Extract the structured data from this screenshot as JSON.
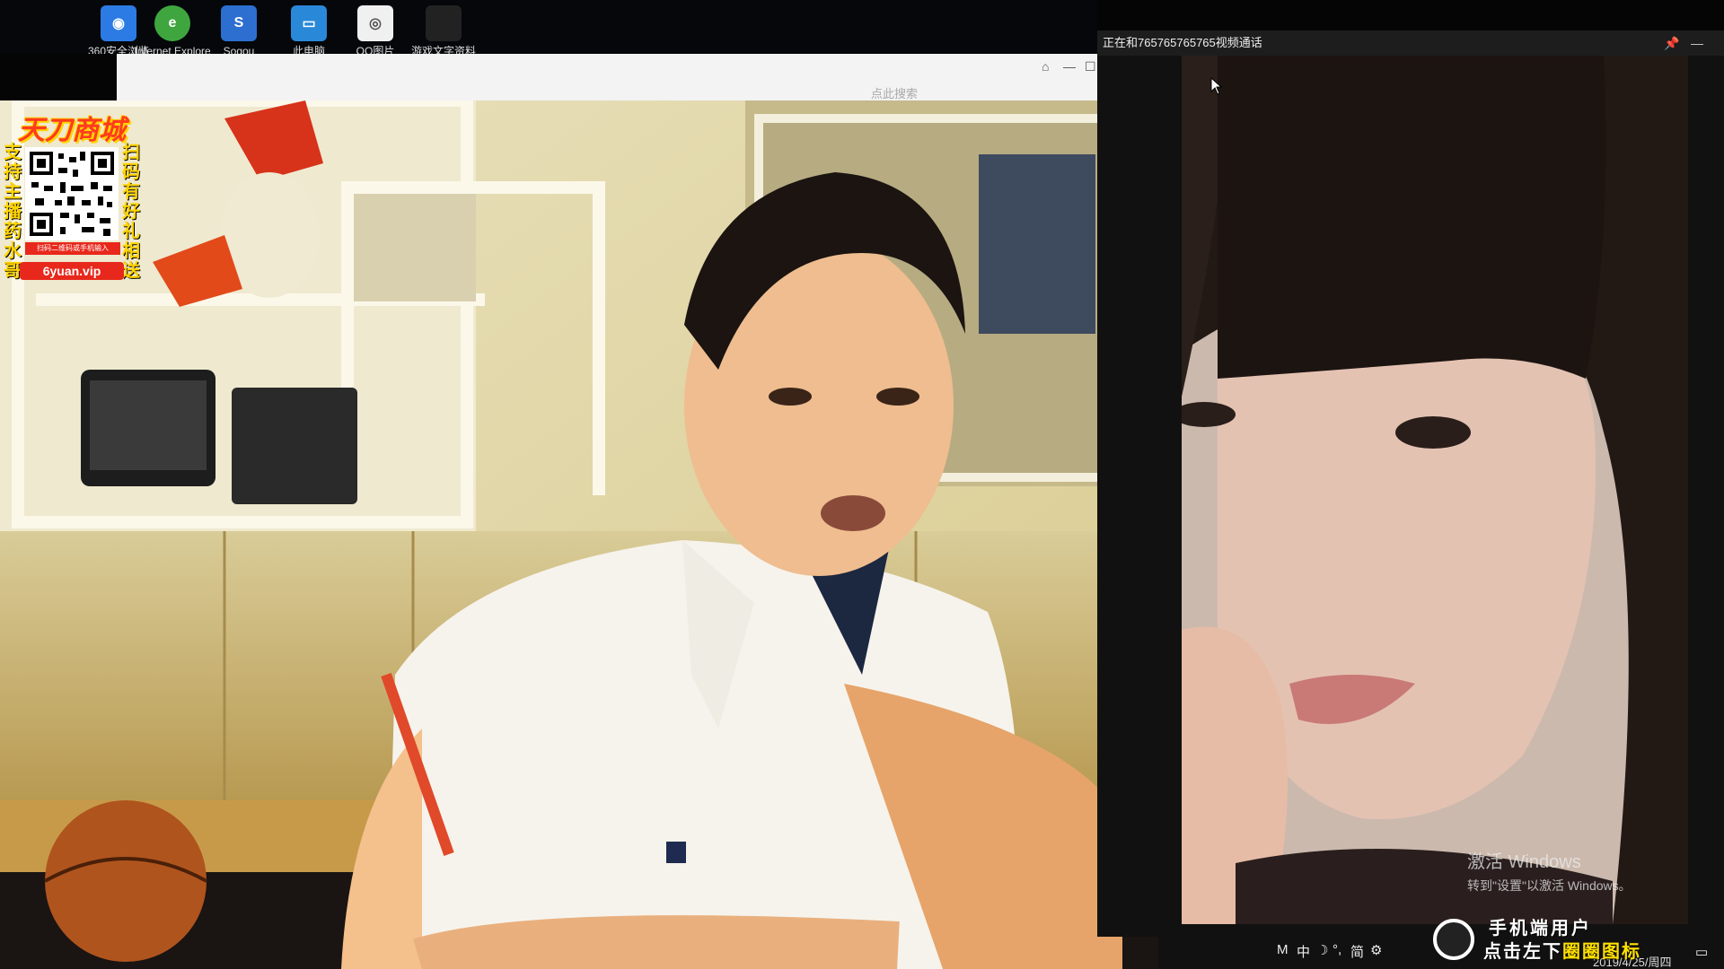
{
  "desktop": {
    "icons": [
      {
        "label": "360安全浏览",
        "icon": "browser-icon",
        "color": "#2c7be5",
        "glyph": "◉"
      },
      {
        "label": "Internet Explorer",
        "icon": "ie-icon",
        "color": "#3fa63f",
        "glyph": "e"
      },
      {
        "label": "Sogou",
        "icon": "sogou-icon",
        "color": "#2c6fd0",
        "glyph": "S"
      },
      {
        "label": "此电脑",
        "icon": "computer-icon",
        "color": "#2a88d8",
        "glyph": "▭"
      },
      {
        "label": "QQ图片",
        "icon": "image-icon",
        "color": "#f0f0f0",
        "glyph": "◎"
      },
      {
        "label": "游戏文字资料",
        "icon": "document-icon",
        "color": "#222",
        "glyph": ""
      }
    ]
  },
  "browser": {
    "search_placeholder": "点此搜索",
    "controls": [
      "⌂",
      "—",
      "☐"
    ]
  },
  "promo": {
    "brand": "天刀商城",
    "left_text": "支持主播药水哥",
    "right_text": "扫码有好礼相送",
    "qr_caption": "扫码二维码或手机输入",
    "url": "6yuan.vip"
  },
  "call": {
    "title": "正在和7657657657​65视频通话",
    "buttons": {
      "pin": "📌",
      "minimize": "—"
    }
  },
  "watermark": {
    "line1": "激活 Windows",
    "line2": "转到\"设置\"以激活 Windows。"
  },
  "mobile_promo": {
    "line1": "手机端用户",
    "line2_prefix": "点击左下",
    "line2_highlight": "圈圈图标"
  },
  "taskbar": {
    "ime_items": [
      "M",
      "中",
      "☽",
      "°,",
      "简",
      "⚙"
    ],
    "date": "2019/4/25/周四"
  },
  "colors": {
    "accent_red": "#e8281c",
    "accent_yellow": "#ffd400"
  }
}
